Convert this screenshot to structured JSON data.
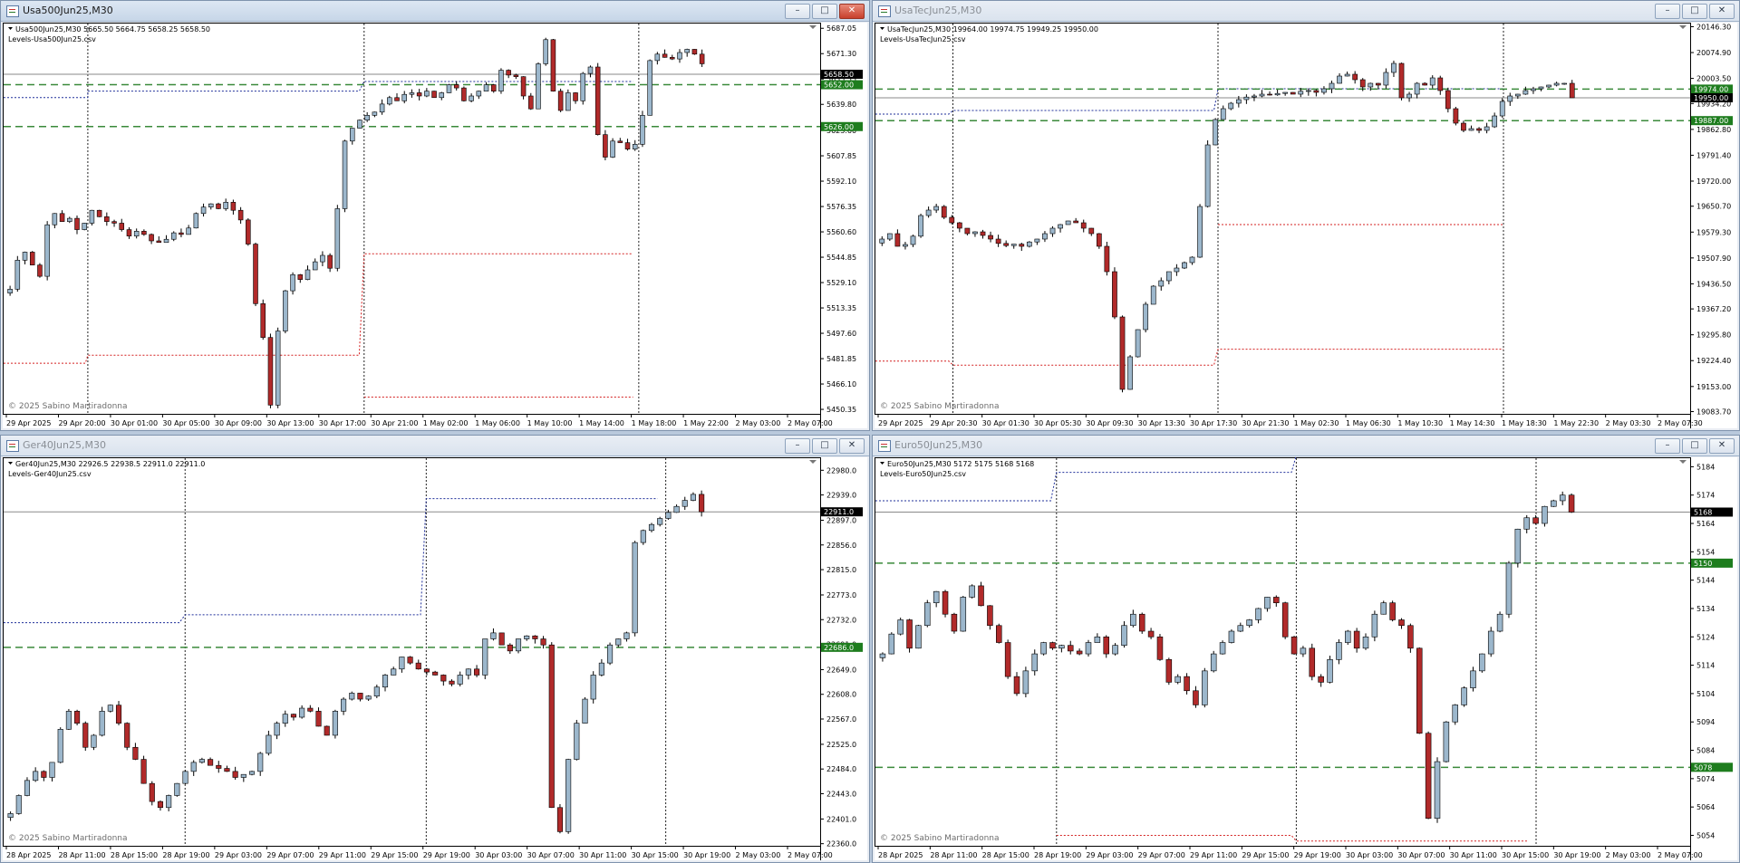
{
  "windows": [
    {
      "id": "usa500",
      "title": "Usa500Jun25,M30",
      "active": true,
      "info_line": "Usa500Jun25,M30  5665.50 5664.75 5658.25 5658.50",
      "levels_file": "Levels-Usa500Jun25.csv",
      "copyright": "© 2025 Sabino Martiradonna",
      "chart_data": {
        "type": "candlestick",
        "y_range": [
          5447,
          5690
        ],
        "y_ticks": [
          "5687.05",
          "5671.30",
          "5655.55",
          "5639.80",
          "5623.60",
          "5607.85",
          "5592.10",
          "5576.35",
          "5560.60",
          "5544.85",
          "5529.10",
          "5513.35",
          "5497.60",
          "5481.85",
          "5466.10",
          "5450.35"
        ],
        "x_labels": [
          "29 Apr 2025",
          "29 Apr 20:00",
          "30 Apr 01:00",
          "30 Apr 05:00",
          "30 Apr 09:00",
          "30 Apr 13:00",
          "30 Apr 17:00",
          "30 Apr 21:00",
          "1 May 02:00",
          "1 May 06:00",
          "1 May 10:00",
          "1 May 14:00",
          "1 May 18:00",
          "1 May 22:00",
          "2 May 03:00",
          "2 May 07:00"
        ],
        "bid_label": "5658.50",
        "green_levels": [
          {
            "price": 5652.0,
            "label": "5652.00"
          },
          {
            "price": 5626.0,
            "label": "5626.00"
          }
        ],
        "current_price": 5658.5,
        "vlines": [
          0.103,
          0.441,
          0.777
        ],
        "step_lines": [
          {
            "color": "blue",
            "points": [
              [
                0,
                5644
              ],
              [
                0.103,
                5644
              ],
              [
                0.103,
                5648
              ],
              [
                0.435,
                5648
              ],
              [
                0.441,
                5654
              ],
              [
                0.77,
                5654
              ]
            ]
          },
          {
            "color": "red",
            "points": [
              [
                0,
                5479
              ],
              [
                0.1,
                5479
              ],
              [
                0.103,
                5484
              ],
              [
                0.435,
                5484
              ],
              [
                0.441,
                5547
              ],
              [
                0.77,
                5547
              ]
            ]
          },
          {
            "color": "red",
            "points": [
              [
                0.441,
                5458
              ],
              [
                0.77,
                5458
              ]
            ]
          }
        ],
        "series": [
          5525,
          5543,
          5548,
          5540,
          5533,
          5565,
          5572,
          5567,
          5569,
          5562,
          5566,
          5574,
          5570,
          5567,
          5566,
          5562,
          5558,
          5561,
          5559,
          5555,
          5554,
          5556,
          5560,
          5559,
          5563,
          5572,
          5576,
          5578,
          5575,
          5579,
          5574,
          5568,
          5553,
          5516,
          5495,
          5453,
          5499,
          5524,
          5534,
          5531,
          5537,
          5542,
          5546,
          5538,
          5575,
          5617,
          5625,
          5630,
          5633,
          5635,
          5640,
          5644,
          5642,
          5646,
          5647,
          5645,
          5648,
          5644,
          5647,
          5652,
          5650,
          5642,
          5645,
          5648,
          5652,
          5648,
          5661,
          5658,
          5657,
          5645,
          5637,
          5665,
          5680,
          5648,
          5636,
          5647,
          5642,
          5659,
          5663,
          5621,
          5607,
          5617,
          5616,
          5612,
          5615,
          5633,
          5667,
          5671,
          5669,
          5668,
          5672,
          5674,
          5671,
          5665
        ]
      }
    },
    {
      "id": "usatec",
      "title": "UsaTecJun25,M30",
      "active": false,
      "info_line": "UsaTecJun25,M30  19964.00 19974.75 19949.25 19950.00",
      "levels_file": "Levels-UsaTecJun25.csv",
      "copyright": "© 2025 Sabino Martiradonna",
      "chart_data": {
        "type": "candlestick",
        "y_range": [
          19075,
          20155
        ],
        "y_ticks": [
          "20146.30",
          "20074.90",
          "20003.50",
          "19934.20",
          "19862.80",
          "19791.40",
          "19720.00",
          "19650.70",
          "19579.30",
          "19507.90",
          "19436.50",
          "19367.20",
          "19295.80",
          "19224.40",
          "19153.00",
          "19083.70"
        ],
        "x_labels": [
          "29 Apr 2025",
          "29 Apr 20:30",
          "30 Apr 01:30",
          "30 Apr 05:30",
          "30 Apr 09:30",
          "30 Apr 13:30",
          "30 Apr 17:30",
          "30 Apr 21:30",
          "1 May 02:30",
          "1 May 06:30",
          "1 May 10:30",
          "1 May 14:30",
          "1 May 18:30",
          "1 May 22:30",
          "2 May 03:30",
          "2 May 07:30"
        ],
        "bid_label": "19950.00",
        "green_levels": [
          {
            "price": 19974.0,
            "label": "19974.00"
          },
          {
            "price": 19887.0,
            "label": "19887.00"
          }
        ],
        "current_price": 19950.0,
        "vlines": [
          0.095,
          0.42,
          0.77
        ],
        "step_lines": [
          {
            "color": "blue",
            "points": [
              [
                0,
                19905
              ],
              [
                0.09,
                19905
              ],
              [
                0.095,
                19915
              ],
              [
                0.415,
                19915
              ],
              [
                0.42,
                19975
              ],
              [
                0.77,
                19975
              ]
            ]
          },
          {
            "color": "red",
            "points": [
              [
                0,
                19223
              ],
              [
                0.09,
                19223
              ],
              [
                0.095,
                19212
              ],
              [
                0.415,
                19212
              ],
              [
                0.42,
                19256
              ],
              [
                0.77,
                19256
              ]
            ]
          },
          {
            "color": "red",
            "points": [
              [
                0.42,
                19600
              ],
              [
                0.77,
                19600
              ]
            ]
          }
        ],
        "series": [
          19560,
          19575,
          19540,
          19545,
          19568,
          19625,
          19640,
          19650,
          19620,
          19605,
          19590,
          19575,
          19580,
          19570,
          19560,
          19548,
          19542,
          19546,
          19540,
          19552,
          19560,
          19575,
          19590,
          19600,
          19610,
          19605,
          19590,
          19575,
          19540,
          19470,
          19345,
          19145,
          19235,
          19310,
          19380,
          19430,
          19445,
          19470,
          19480,
          19495,
          19510,
          19650,
          19820,
          19890,
          19920,
          19935,
          19945,
          19952,
          19955,
          19960,
          19958,
          19962,
          19965,
          19960,
          19968,
          19970,
          19965,
          19975,
          19990,
          20010,
          20015,
          20000,
          19980,
          19990,
          19985,
          20020,
          20045,
          19950,
          19960,
          19990,
          19985,
          20005,
          19970,
          19920,
          19880,
          19860,
          19865,
          19860,
          19870,
          19900,
          19940,
          19955,
          19960,
          19970,
          19975,
          19980,
          19985,
          19990,
          19990,
          19950
        ]
      }
    },
    {
      "id": "ger40",
      "title": "Ger40Jun25,M30",
      "active": false,
      "info_line": "Ger40Jun25,M30  22926.5 22938.5 22911.0 22911.0",
      "levels_file": "Levels-Ger40Jun25.csv",
      "copyright": "© 2025 Sabino Martiradonna",
      "chart_data": {
        "type": "candlestick",
        "y_range": [
          22355,
          23000
        ],
        "y_ticks": [
          "22980.0",
          "22939.0",
          "22897.0",
          "22856.0",
          "22815.0",
          "22773.0",
          "22732.0",
          "22691.0",
          "22649.0",
          "22608.0",
          "22567.0",
          "22525.0",
          "22484.0",
          "22443.0",
          "22401.0",
          "22360.0"
        ],
        "x_labels": [
          "28 Apr 2025",
          "28 Apr 11:00",
          "28 Apr 15:00",
          "28 Apr 19:00",
          "29 Apr 03:00",
          "29 Apr 07:00",
          "29 Apr 11:00",
          "29 Apr 15:00",
          "29 Apr 19:00",
          "30 Apr 03:00",
          "30 Apr 07:00",
          "30 Apr 11:00",
          "30 Apr 15:00",
          "30 Apr 19:00",
          "2 May 03:00",
          "2 May 07:00"
        ],
        "bid_label": "22911.0",
        "green_levels": [
          {
            "price": 22686.0,
            "label": "22686.0"
          }
        ],
        "current_price": 22911.0,
        "vlines": [
          0.222,
          0.517,
          0.81
        ],
        "step_lines": [
          {
            "color": "blue",
            "points": [
              [
                0,
                22727
              ],
              [
                0.215,
                22727
              ],
              [
                0.222,
                22740
              ],
              [
                0.51,
                22740
              ],
              [
                0.517,
                22933
              ],
              [
                0.8,
                22933
              ]
            ]
          }
        ],
        "series": [
          22410,
          22440,
          22465,
          22480,
          22470,
          22495,
          22550,
          22580,
          22560,
          22520,
          22540,
          22580,
          22590,
          22560,
          22520,
          22500,
          22460,
          22430,
          22420,
          22440,
          22460,
          22480,
          22495,
          22500,
          22490,
          22485,
          22480,
          22470,
          22475,
          22480,
          22510,
          22540,
          22560,
          22575,
          22570,
          22585,
          22580,
          22555,
          22540,
          22580,
          22600,
          22610,
          22600,
          22605,
          22620,
          22640,
          22650,
          22670,
          22660,
          22650,
          22645,
          22640,
          22630,
          22625,
          22640,
          22650,
          22640,
          22700,
          22710,
          22690,
          22680,
          22700,
          22705,
          22700,
          22690,
          22420,
          22380,
          22500,
          22560,
          22600,
          22640,
          22660,
          22690,
          22700,
          22710,
          22860,
          22880,
          22890,
          22900,
          22910,
          22920,
          22930,
          22940,
          22911
        ]
      }
    },
    {
      "id": "euro50",
      "title": "Euro50Jun25,M30",
      "active": false,
      "info_line": "Euro50Jun25,M30  5172 5175 5168 5168",
      "levels_file": "Levels-Euro50Jun25.csv",
      "copyright": "© 2025 Sabino Martiradonna",
      "chart_data": {
        "type": "candlestick",
        "y_range": [
          5050,
          5187
        ],
        "y_ticks": [
          "5184",
          "5174",
          "5164",
          "5154",
          "5144",
          "5134",
          "5124",
          "5114",
          "5104",
          "5094",
          "5084",
          "5074",
          "5064",
          "5054"
        ],
        "x_labels": [
          "28 Apr 2025",
          "28 Apr 11:00",
          "28 Apr 15:00",
          "28 Apr 19:00",
          "29 Apr 03:00",
          "29 Apr 07:00",
          "29 Apr 11:00",
          "29 Apr 15:00",
          "29 Apr 19:00",
          "30 Apr 03:00",
          "30 Apr 07:00",
          "30 Apr 11:00",
          "30 Apr 15:00",
          "30 Apr 19:00",
          "2 May 03:00",
          "2 May 07:00"
        ],
        "bid_label": "5168",
        "green_levels": [
          {
            "price": 5150.0,
            "label": "5150"
          },
          {
            "price": 5078.0,
            "label": "5078"
          }
        ],
        "current_price": 5168.0,
        "vlines": [
          0.222,
          0.516,
          0.81
        ],
        "step_lines": [
          {
            "color": "blue",
            "points": [
              [
                0,
                5172
              ],
              [
                0.215,
                5172
              ],
              [
                0.222,
                5182
              ],
              [
                0.51,
                5182
              ],
              [
                0.516,
                5188
              ],
              [
                0.8,
                5188
              ]
            ]
          },
          {
            "color": "red",
            "points": [
              [
                0.222,
                5054
              ],
              [
                0.51,
                5054
              ],
              [
                0.516,
                5052
              ],
              [
                0.8,
                5052
              ]
            ]
          }
        ],
        "series": [
          5118,
          5125,
          5130,
          5120,
          5128,
          5136,
          5140,
          5132,
          5126,
          5138,
          5142,
          5135,
          5128,
          5122,
          5110,
          5104,
          5112,
          5118,
          5122,
          5120,
          5121,
          5119,
          5118,
          5122,
          5124,
          5118,
          5121,
          5128,
          5132,
          5126,
          5124,
          5116,
          5108,
          5110,
          5105,
          5100,
          5112,
          5118,
          5122,
          5126,
          5128,
          5130,
          5134,
          5138,
          5136,
          5124,
          5118,
          5120,
          5110,
          5108,
          5116,
          5122,
          5126,
          5120,
          5124,
          5132,
          5136,
          5130,
          5128,
          5120,
          5090,
          5060,
          5080,
          5094,
          5100,
          5106,
          5112,
          5118,
          5126,
          5132,
          5150,
          5162,
          5166,
          5164,
          5170,
          5172,
          5174,
          5168
        ]
      }
    }
  ]
}
